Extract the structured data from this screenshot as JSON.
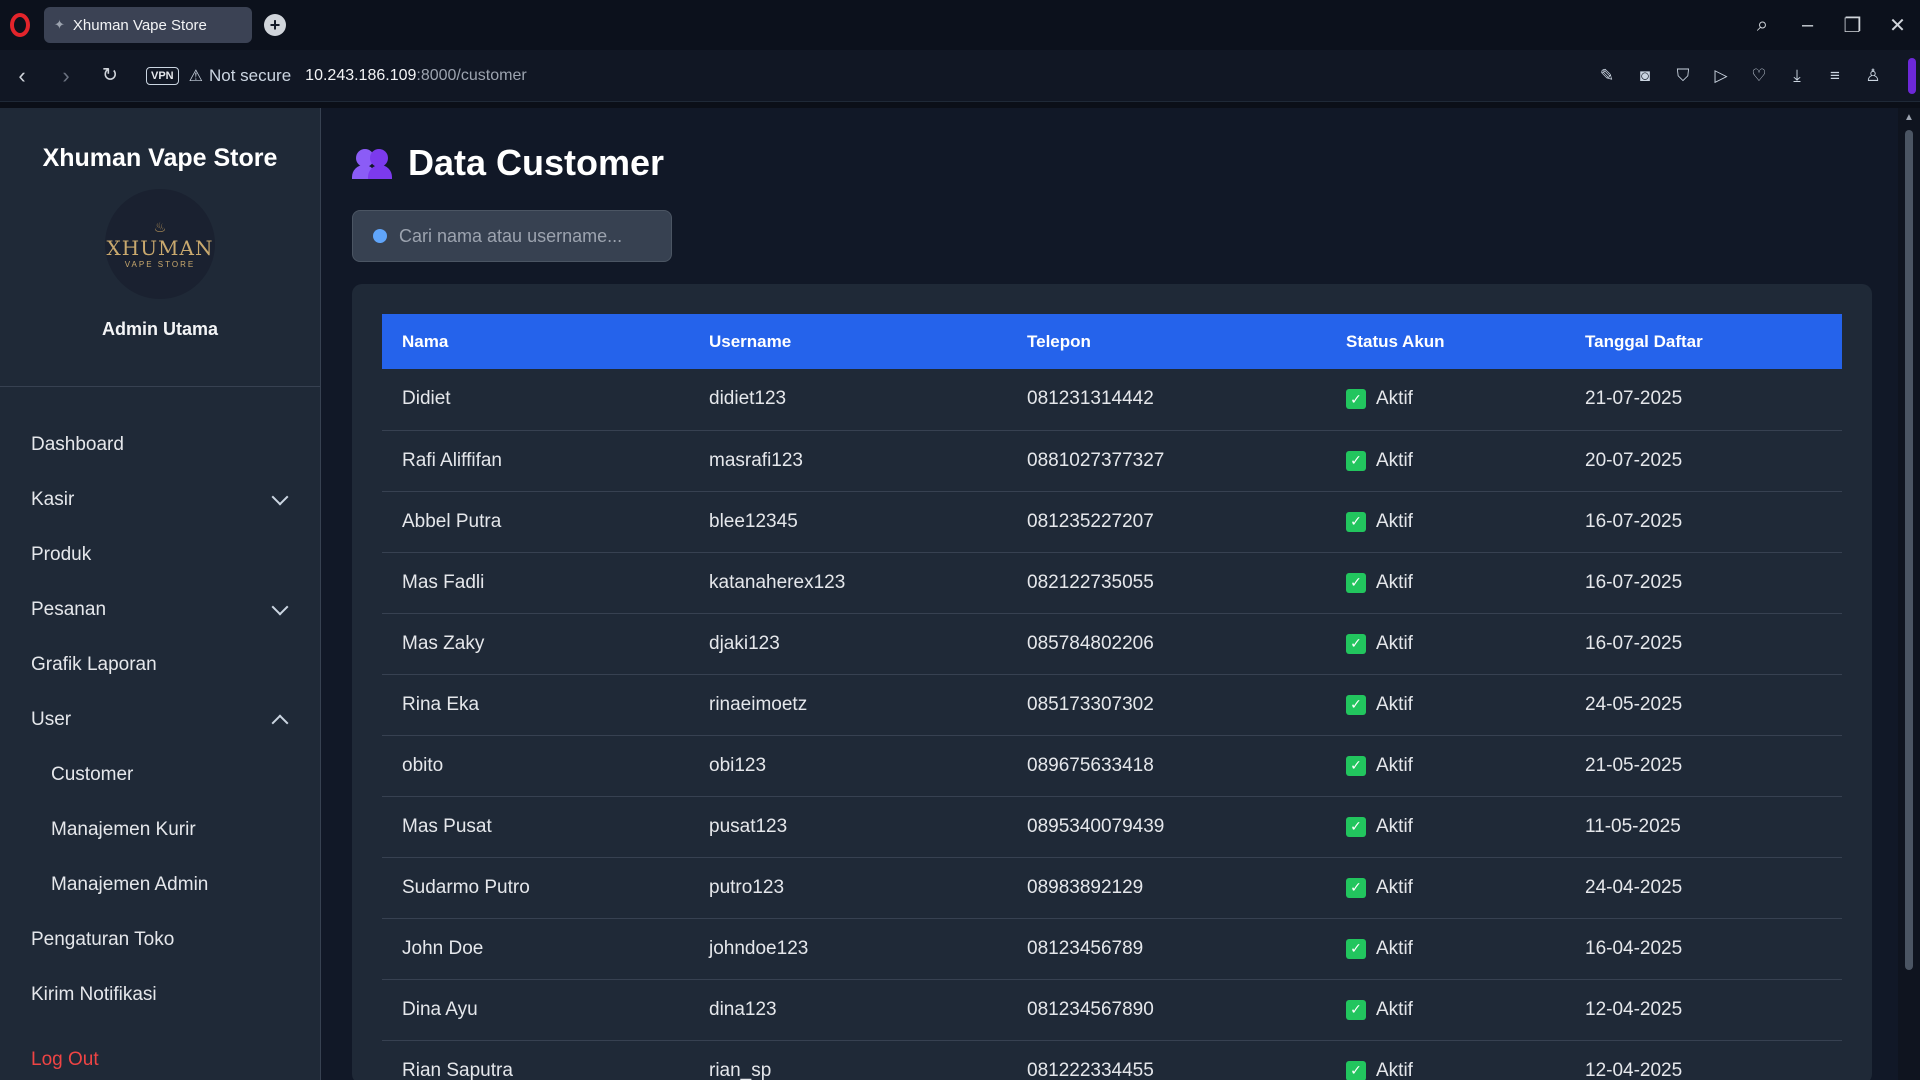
{
  "browser": {
    "tab_title": "Xhuman Vape Store",
    "vpn_label": "VPN",
    "security_label": "Not secure",
    "url_host": "10.243.186.109",
    "url_path": ":8000/customer"
  },
  "sidebar": {
    "brand": "Xhuman Vape Store",
    "logo_text": "XHUMAN",
    "logo_subtext": "VAPE STORE",
    "role": "Admin Utama",
    "items": [
      {
        "label": "Dashboard",
        "chevron": "none"
      },
      {
        "label": "Kasir",
        "chevron": "down"
      },
      {
        "label": "Produk",
        "chevron": "none"
      },
      {
        "label": "Pesanan",
        "chevron": "down"
      },
      {
        "label": "Grafik Laporan",
        "chevron": "none"
      },
      {
        "label": "User",
        "chevron": "up"
      }
    ],
    "user_subitems": [
      "Customer",
      "Manajemen Kurir",
      "Manajemen Admin"
    ],
    "bottom_items": [
      "Pengaturan Toko",
      "Kirim Notifikasi"
    ],
    "logout": "Log Out"
  },
  "main": {
    "title": "Data Customer",
    "title_icon": "users-icon",
    "search_placeholder": "Cari nama atau username...",
    "table": {
      "headers": [
        "Nama",
        "Username",
        "Telepon",
        "Status Akun",
        "Tanggal Daftar"
      ],
      "rows": [
        {
          "nama": "Didiet",
          "username": "didiet123",
          "telepon": "081231314442",
          "status": "Aktif",
          "tanggal": "21-07-2025"
        },
        {
          "nama": "Rafi Aliffifan",
          "username": "masrafi123",
          "telepon": "0881027377327",
          "status": "Aktif",
          "tanggal": "20-07-2025"
        },
        {
          "nama": "Abbel Putra",
          "username": "blee12345",
          "telepon": "081235227207",
          "status": "Aktif",
          "tanggal": "16-07-2025"
        },
        {
          "nama": "Mas Fadli",
          "username": "katanaherex123",
          "telepon": "082122735055",
          "status": "Aktif",
          "tanggal": "16-07-2025"
        },
        {
          "nama": "Mas Zaky",
          "username": "djaki123",
          "telepon": "085784802206",
          "status": "Aktif",
          "tanggal": "16-07-2025"
        },
        {
          "nama": "Rina Eka",
          "username": "rinaeimoetz",
          "telepon": "085173307302",
          "status": "Aktif",
          "tanggal": "24-05-2025"
        },
        {
          "nama": "obito",
          "username": "obi123",
          "telepon": "089675633418",
          "status": "Aktif",
          "tanggal": "21-05-2025"
        },
        {
          "nama": "Mas Pusat",
          "username": "pusat123",
          "telepon": "0895340079439",
          "status": "Aktif",
          "tanggal": "11-05-2025"
        },
        {
          "nama": "Sudarmo Putro",
          "username": "putro123",
          "telepon": "08983892129",
          "status": "Aktif",
          "tanggal": "24-04-2025"
        },
        {
          "nama": "John Doe",
          "username": "johndoe123",
          "telepon": "08123456789",
          "status": "Aktif",
          "tanggal": "16-04-2025"
        },
        {
          "nama": "Dina Ayu",
          "username": "dina123",
          "telepon": "081234567890",
          "status": "Aktif",
          "tanggal": "12-04-2025"
        },
        {
          "nama": "Rian Saputra",
          "username": "rian_sp",
          "telepon": "081222334455",
          "status": "Aktif",
          "tanggal": "12-04-2025"
        }
      ]
    }
  },
  "colors": {
    "header_blue": "#2563eb",
    "status_green": "#22c55e",
    "logout_red": "#ef4444",
    "sidebar_bg": "#1f2937",
    "page_bg": "#111827"
  }
}
